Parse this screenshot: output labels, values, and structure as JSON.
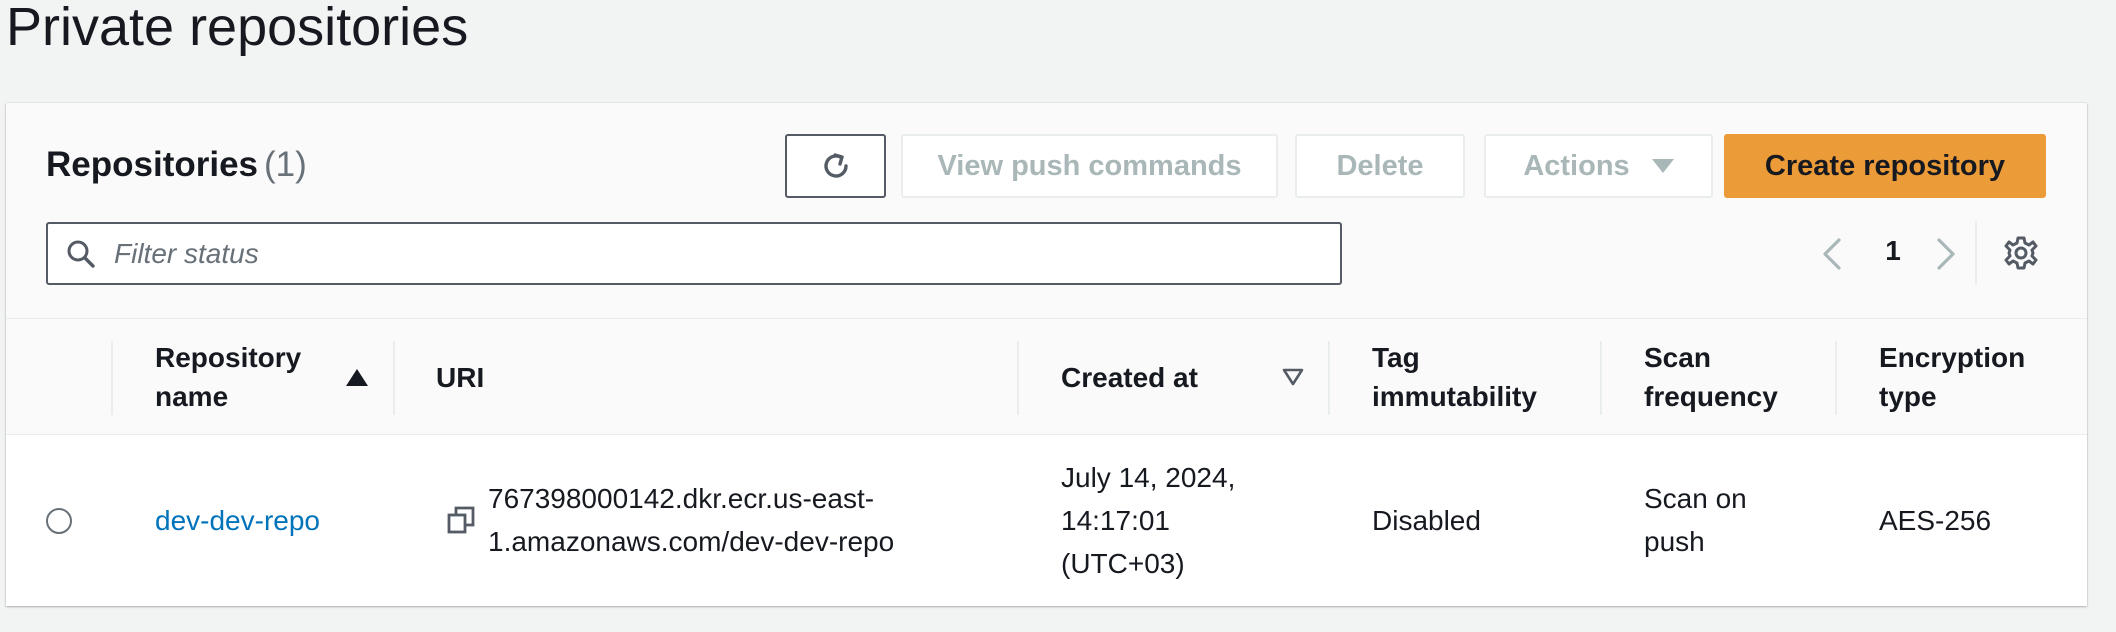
{
  "page": {
    "title": "Private repositories"
  },
  "panel": {
    "title": "Repositories",
    "count": "(1)"
  },
  "toolbar": {
    "refresh_icon": "refresh-icon",
    "view_push_label": "View push commands",
    "delete_label": "Delete",
    "actions_label": "Actions",
    "create_label": "Create repository"
  },
  "filter": {
    "placeholder": "Filter status",
    "value": ""
  },
  "pagination": {
    "current_page": "1"
  },
  "table": {
    "columns": [
      {
        "label": "Repository name",
        "line1": "Repository",
        "line2": "name",
        "sort": "ascending"
      },
      {
        "label": "URI"
      },
      {
        "label": "Created at",
        "sort": "descending-inactive"
      },
      {
        "label": "Tag immutability",
        "line1": "Tag",
        "line2": "immutability"
      },
      {
        "label": "Scan frequency",
        "line1": "Scan",
        "line2": "frequency"
      },
      {
        "label": "Encryption type",
        "line1": "Encryption",
        "line2": "type"
      }
    ],
    "rows": [
      {
        "selected": false,
        "name": "dev-dev-repo",
        "uri_line1": "767398000142.dkr.ecr.us-east-",
        "uri_line2": "1.amazonaws.com/dev-dev-repo",
        "created_line1": "July 14, 2024,",
        "created_line2": "14:17:01",
        "created_line3": "(UTC+03)",
        "tag_immutability": "Disabled",
        "scan_line1": "Scan on",
        "scan_line2": "push",
        "encryption": "AES-256"
      }
    ]
  },
  "colors": {
    "primary_button": "#ec9b39",
    "link": "#0073bb",
    "disabled_text": "#aab7b8",
    "background": "#f2f3f3"
  }
}
